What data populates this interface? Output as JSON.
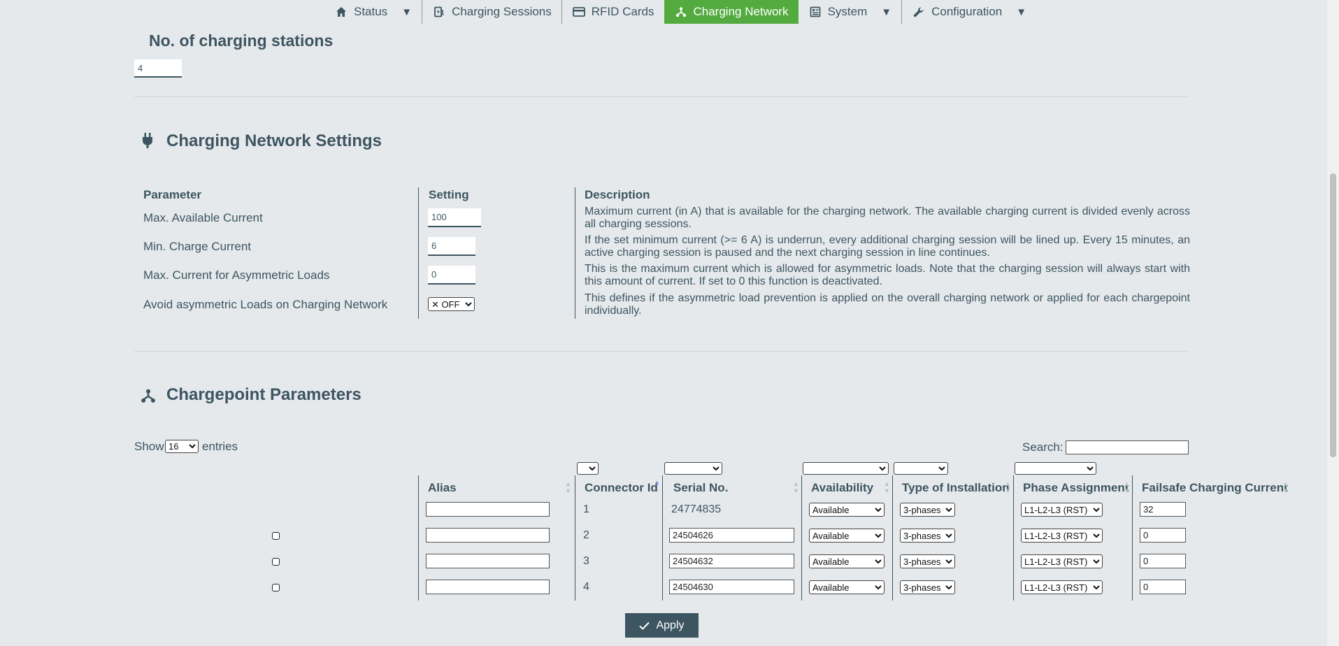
{
  "nav": {
    "items": [
      {
        "label": "Status",
        "icon": "home-icon",
        "has_caret": true
      },
      {
        "label": "Charging Sessions",
        "icon": "charging-station-icon",
        "has_caret": false
      },
      {
        "label": "RFID Cards",
        "icon": "card-icon",
        "has_caret": false
      },
      {
        "label": "Charging Network",
        "icon": "network-icon",
        "has_caret": false,
        "active": true
      },
      {
        "label": "System",
        "icon": "system-icon",
        "has_caret": true
      },
      {
        "label": "Configuration",
        "icon": "wrench-icon",
        "has_caret": true
      }
    ],
    "caret": "▼",
    "active_color": "#53ab3f"
  },
  "stations": {
    "title": "No. of charging stations",
    "value": "4"
  },
  "settings": {
    "title": "Charging Network Settings",
    "headers": {
      "parameter": "Parameter",
      "setting": "Setting",
      "description": "Description"
    },
    "rows": [
      {
        "param": "Max. Available Current",
        "value": "100",
        "description": "Maximum current (in A) that is available for the charging network. The available charging current is divided evenly across all charging sessions."
      },
      {
        "param": "Min. Charge Current",
        "value": "6",
        "description": "If the set minimum current (>= 6 A) is underrun, every additional charging session will be lined up. Every 15 minutes, an active charging session is paused and the next charging session in line continues."
      },
      {
        "param": "Max. Current for Asymmetric Loads",
        "value": "0",
        "description": "This is the maximum current which is allowed for asymmetric loads. Note that the charging session will always start with this amount of current. If set to 0 this function is deactivated."
      },
      {
        "param": "Avoid asymmetric Loads on Charging Network",
        "value": "✕ OFF",
        "description": "This defines if the asymmetric load prevention is applied on the overall charging network or applied for each chargepoint individually."
      }
    ]
  },
  "chargepoints": {
    "title": "Chargepoint Parameters",
    "show_label": "Show",
    "entries_value": "16",
    "entries_label": "entries",
    "search_label": "Search:",
    "columns": [
      "Alias",
      "Connector Id",
      "Serial No.",
      "Availability",
      "Type of Installation",
      "Phase Assignment",
      "Failsafe Charging Current"
    ],
    "rows": [
      {
        "alias": "",
        "connector": "1",
        "serial": "24774835",
        "availability": "Available",
        "installation": "3-phases",
        "phase": "L1-L2-L3 (RST)",
        "failsafe": "32"
      },
      {
        "alias": "",
        "connector": "2",
        "serial": "24504626",
        "availability": "Available",
        "installation": "3-phases",
        "phase": "L1-L2-L3 (RST)",
        "failsafe": "0"
      },
      {
        "alias": "",
        "connector": "3",
        "serial": "24504632",
        "availability": "Available",
        "installation": "3-phases",
        "phase": "L1-L2-L3 (RST)",
        "failsafe": "0"
      },
      {
        "alias": "",
        "connector": "4",
        "serial": "24504630",
        "availability": "Available",
        "installation": "3-phases",
        "phase": "L1-L2-L3 (RST)",
        "failsafe": "0"
      }
    ]
  },
  "apply_label": "Apply"
}
